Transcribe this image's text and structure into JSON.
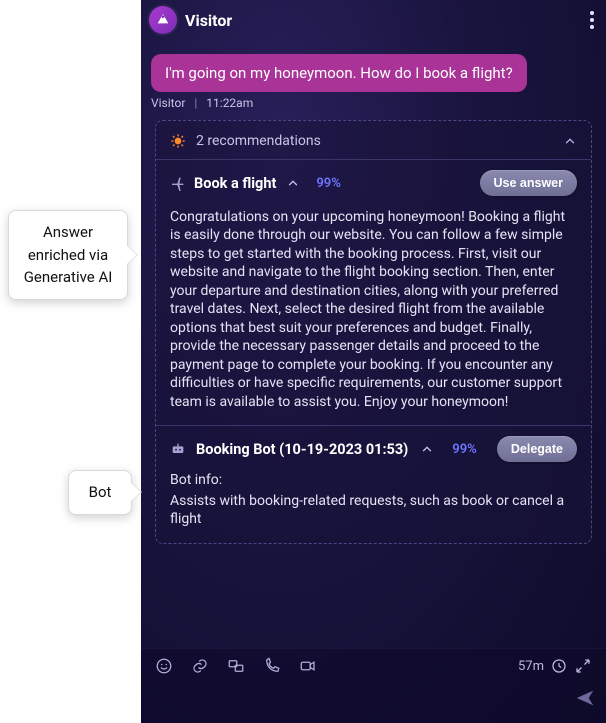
{
  "header": {
    "visitor_name": "Visitor"
  },
  "message": {
    "text": "I'm going on my honeymoon. How do I book a flight?",
    "sender": "Visitor",
    "time": "11:22am"
  },
  "recommendations": {
    "title": "2 recommendations",
    "items": [
      {
        "title": "Book a flight",
        "confidence": "99%",
        "action_label": "Use answer",
        "body": "Congratulations on your upcoming honeymoon! Booking a flight is easily done through our website. You can follow a few simple steps to get started with the booking process. First, visit our website and navigate to the flight booking section. Then, enter your departure and destination cities, along with your preferred travel dates. Next, select the desired flight from the available options that best suit your preferences and budget. Finally, provide the necessary passenger details and proceed to the payment page to complete your booking. If you encounter any difficulties or have specific requirements, our customer support team is available to assist you. Enjoy your honeymoon!"
      },
      {
        "title": "Booking Bot (10-19-2023 01:53)",
        "confidence": "99%",
        "action_label": "Delegate",
        "subhead": "Bot info:",
        "body": "Assists with booking-related requests, such as book or cancel a flight"
      }
    ]
  },
  "composer": {
    "timer": "57m"
  },
  "annotations": {
    "ai": "Answer enriched via Generative AI",
    "bot": "Bot"
  }
}
